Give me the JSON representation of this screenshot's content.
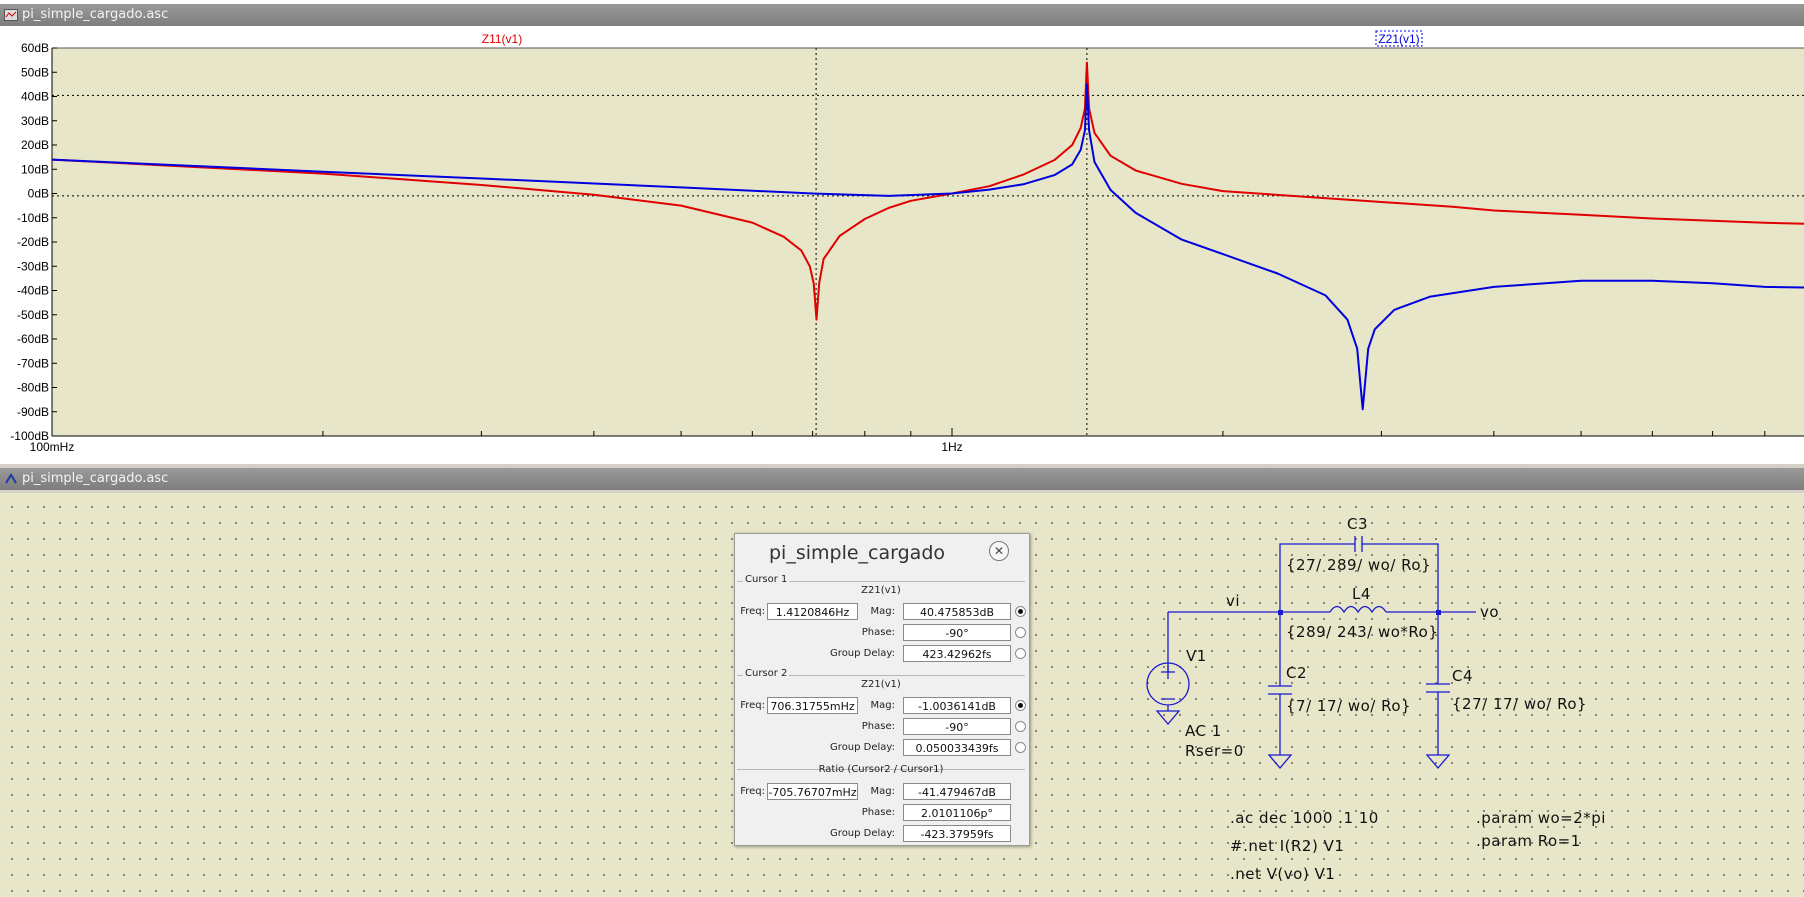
{
  "plot_window": {
    "title": "pi_simple_cargado.asc"
  },
  "schematic_window": {
    "title": "pi_simple_cargado.asc"
  },
  "chart_data": {
    "type": "line",
    "xscale": "log",
    "xlim": [
      0.1,
      10
    ],
    "ylim": [
      -100,
      60
    ],
    "y_ticks": [
      "60dB",
      "50dB",
      "40dB",
      "30dB",
      "20dB",
      "10dB",
      "0dB",
      "-10dB",
      "-20dB",
      "-30dB",
      "-40dB",
      "-50dB",
      "-60dB",
      "-70dB",
      "-80dB",
      "-90dB",
      "-100dB"
    ],
    "x_ticks": [
      "100mHz",
      "1Hz"
    ],
    "trace_labels": [
      "Z11(v1)",
      "Z21(v1)"
    ],
    "cursors": {
      "cursor1_hz": 1.4120846,
      "cursor2_hz": 0.70631755,
      "cursor1_db": 40.475853,
      "cursor2_db": -1.0036141
    },
    "series": [
      {
        "name": "Z11(v1)",
        "color": "#e00000",
        "x": [
          0.1,
          0.2,
          0.3,
          0.4,
          0.5,
          0.6,
          0.65,
          0.68,
          0.695,
          0.702,
          0.707,
          0.712,
          0.72,
          0.75,
          0.8,
          0.85,
          0.9,
          1.0,
          1.1,
          1.2,
          1.3,
          1.36,
          1.39,
          1.405,
          1.412,
          1.42,
          1.44,
          1.5,
          1.6,
          1.8,
          2.0,
          2.5,
          3.0,
          3.6,
          4.0,
          5.0,
          6.0,
          8.0,
          10.0
        ],
        "y": [
          14,
          8.2,
          3.5,
          -0.5,
          -5,
          -12,
          -17.8,
          -23.5,
          -30,
          -37,
          -52,
          -37,
          -27,
          -17.5,
          -10.5,
          -6,
          -3,
          0,
          3,
          7.8,
          13.8,
          20,
          27,
          35,
          54,
          35,
          25,
          15.6,
          9.5,
          4,
          1,
          -1.5,
          -3.5,
          -5.5,
          -7,
          -8.8,
          -10.3,
          -12.1,
          -13
        ]
      },
      {
        "name": "Z21(v1)",
        "color": "#0000e0",
        "x": [
          0.1,
          0.2,
          0.3,
          0.5,
          0.7,
          0.85,
          1.0,
          1.1,
          1.2,
          1.3,
          1.36,
          1.39,
          1.405,
          1.412,
          1.42,
          1.44,
          1.5,
          1.6,
          1.8,
          2.0,
          2.3,
          2.6,
          2.75,
          2.82,
          2.86,
          2.9,
          2.95,
          3.1,
          3.4,
          4.0,
          5.0,
          6.0,
          7.0,
          8.0,
          10.0
        ],
        "y": [
          14,
          9,
          6.2,
          2.5,
          0,
          -1,
          0,
          1.6,
          3.8,
          7.6,
          12,
          18,
          26,
          45,
          26,
          13,
          1.5,
          -8,
          -19,
          -25,
          -33,
          -42,
          -52,
          -64,
          -89,
          -64,
          -56,
          -48,
          -42.5,
          -38.5,
          -36,
          -36,
          -37,
          -38.5,
          -39
        ]
      }
    ]
  },
  "dialog": {
    "title": "pi_simple_cargado",
    "cursor1": {
      "label": "Cursor 1",
      "trace": "Z21(v1)",
      "freq": "1.4120846Hz",
      "mag": "40.475853dB",
      "phase": "-90°",
      "group_delay": "423.42962fs"
    },
    "cursor2": {
      "label": "Cursor 2",
      "trace": "Z21(v1)",
      "freq": "706.31755mHz",
      "mag": "-1.0036141dB",
      "phase": "-90°",
      "group_delay": "0.050033439fs"
    },
    "ratio": {
      "label": "Ratio (Cursor2 / Cursor1)",
      "freq": "-705.76707mHz",
      "mag": "-41.479467dB",
      "phase": "2.0101106p°",
      "group_delay": "-423.37959fs"
    },
    "labels": {
      "freq": "Freq:",
      "mag": "Mag:",
      "phase": "Phase:",
      "group_delay": "Group Delay:"
    }
  },
  "schematic": {
    "c3": {
      "name": "C3",
      "value": "{27/ 289/ wo/ Ro}"
    },
    "l4": {
      "name": "L4",
      "value": "{289/ 243/ wo*Ro}"
    },
    "c2": {
      "name": "C2",
      "value": "{7/ 17/ wo/ Ro}"
    },
    "c4": {
      "name": "C4",
      "value": "{27/ 17/ wo/ Ro}"
    },
    "v1": {
      "name": "V1",
      "ac": "AC 1",
      "rser": "Rser=0"
    },
    "nets": {
      "vi": "vi",
      "vo": "vo"
    },
    "directives": [
      ".ac dec 1000 .1 10",
      "#.net I(R2) V1",
      ".net V(vo) V1",
      ".param wo=2*pi",
      ".param Ro=1"
    ]
  }
}
